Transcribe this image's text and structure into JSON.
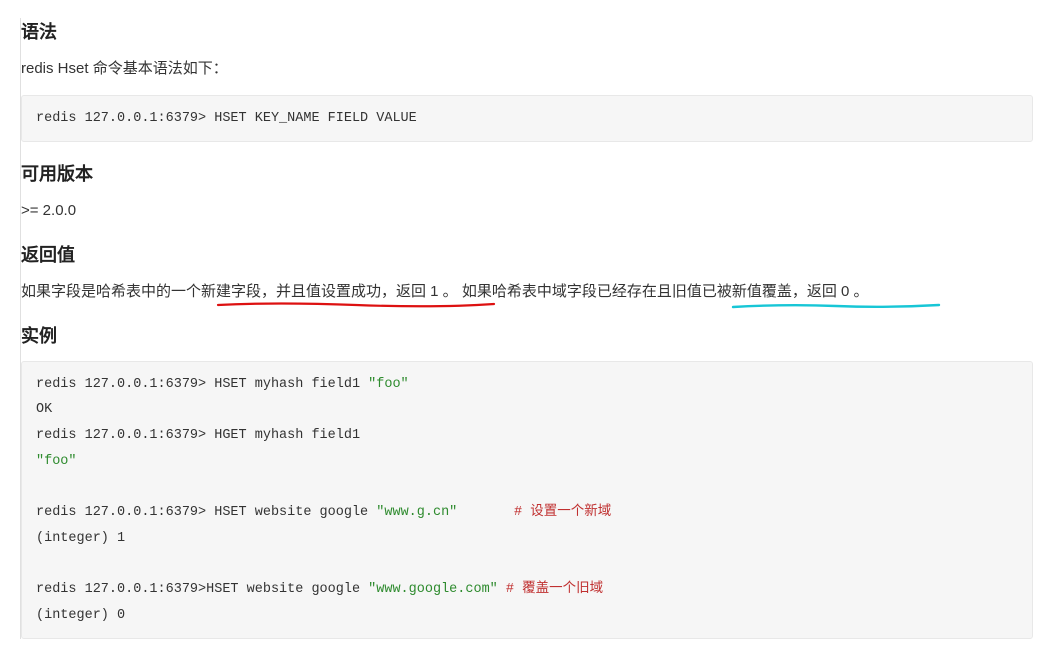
{
  "sections": {
    "syntax": {
      "heading": "语法",
      "intro": "redis Hset 命令基本语法如下：",
      "code": "redis 127.0.0.1:6379> HSET KEY_NAME FIELD VALUE"
    },
    "version": {
      "heading": "可用版本",
      "text": ">= 2.0.0"
    },
    "return": {
      "heading": "返回值",
      "para_a": "如果字段是哈希表中的一个新建字段，并且值设置成功，返回 1 。 ",
      "para_b": "如果哈希表中域字段已经存在且旧值已被新值覆盖，返回 0 。"
    },
    "example": {
      "heading": "实例",
      "lines": [
        {
          "plain": "redis 127.0.0.1:6379> HSET myhash field1 ",
          "str": "\"foo\""
        },
        {
          "plain": "OK"
        },
        {
          "plain": "redis 127.0.0.1:6379> HGET myhash field1"
        },
        {
          "str": "\"foo\""
        },
        {
          "plain": ""
        },
        {
          "plain": "redis 127.0.0.1:6379> HSET website google ",
          "str": "\"www.g.cn\"",
          "pad": "       ",
          "comment": "# 设置一个新域"
        },
        {
          "plain": "(integer) 1"
        },
        {
          "plain": ""
        },
        {
          "plain": "redis 127.0.0.1:6379>HSET website google ",
          "str": "\"www.google.com\"",
          "pad": " ",
          "comment": "# 覆盖一个旧域"
        },
        {
          "plain": "(integer) 0"
        }
      ]
    }
  }
}
